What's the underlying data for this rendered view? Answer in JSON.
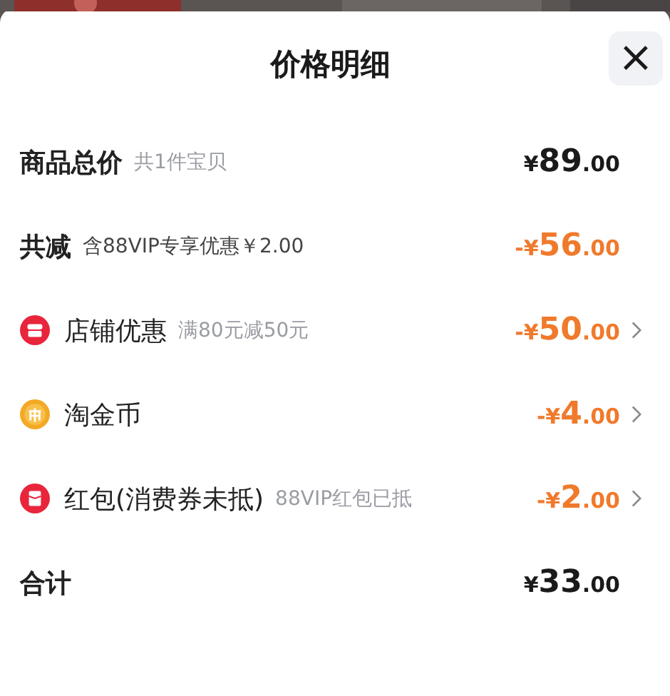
{
  "title": "价格明细",
  "close_button": {
    "label": "×"
  },
  "rows": [
    {
      "kind": "subtotal",
      "label": "商品总价",
      "note": "共1件宝贝",
      "amount": {
        "currency": "¥",
        "whole": "89",
        "cents": ".00"
      },
      "negative": false,
      "chevron": false
    },
    {
      "kind": "savings",
      "label": "共减",
      "note": "含88VIP专享优惠￥2.00",
      "amount": {
        "currency": "-¥",
        "whole": "56",
        "cents": ".00"
      },
      "negative": true,
      "chevron": false
    },
    {
      "kind": "shop",
      "label": "店铺优惠",
      "note": "满80元减50元",
      "amount": {
        "currency": "-¥",
        "whole": "50",
        "cents": ".00"
      },
      "negative": true,
      "chevron": true
    },
    {
      "kind": "coin",
      "label": "淘金币",
      "amount": {
        "currency": "-¥",
        "whole": "4",
        "cents": ".00"
      },
      "negative": true,
      "chevron": true
    },
    {
      "kind": "packet",
      "label": "红包(消费券未抵)",
      "note": "88VIP红包已抵",
      "amount": {
        "currency": "-¥",
        "whole": "2",
        "cents": ".00"
      },
      "negative": true,
      "chevron": true
    },
    {
      "kind": "total",
      "label": "合计",
      "amount": {
        "currency": "¥",
        "whole": "33",
        "cents": ".00"
      },
      "negative": false,
      "chevron": false
    }
  ]
}
